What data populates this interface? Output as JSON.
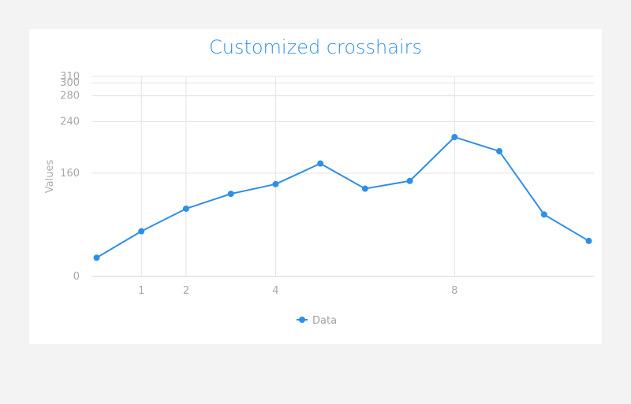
{
  "chart_data": {
    "type": "line",
    "title": "Customized crosshairs",
    "xlabel": "",
    "ylabel": "Values",
    "x": [
      0,
      1,
      2,
      3,
      4,
      5,
      6,
      7,
      8,
      9,
      10,
      11
    ],
    "x_ticks": [
      1,
      2,
      4,
      8
    ],
    "y_ticks": [
      0,
      160,
      240,
      280,
      300,
      310
    ],
    "xlim": [
      0,
      11
    ],
    "ylim": [
      0,
      310
    ],
    "grid": true,
    "legend_position": "bottom",
    "series": [
      {
        "name": "Data",
        "color": "#2e8fe6",
        "values": [
          29,
          70,
          105,
          128,
          143,
          175,
          136,
          148,
          216,
          194,
          96,
          55
        ]
      }
    ]
  }
}
